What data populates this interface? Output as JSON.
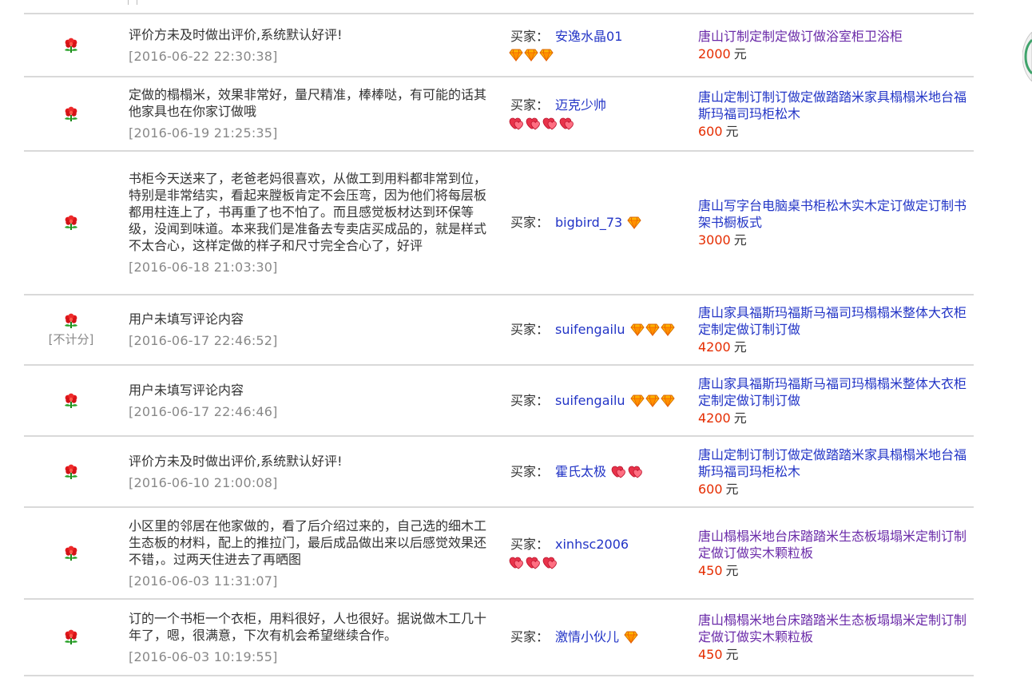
{
  "colors": {
    "divider": "#d9d9d9",
    "link": "#2234c6",
    "visited_link": "#6a2aa8",
    "price": "#e52c00",
    "muted": "#888888"
  },
  "labels": {
    "buyer": "买家：",
    "currency_unit": "元",
    "not_counted": "[不计分]"
  },
  "reviews": [
    {
      "rating_icon": "red-flower-icon",
      "comment": "评价方未及时做出评价,系统默认好评!",
      "date": "[2016-06-22 22:30:38]",
      "buyer_name": "安逸水晶01",
      "buyer_badge": "diamond-icon",
      "buyer_badge_count": 3,
      "item_title": "唐山订制定制定做订做浴室柜卫浴柜",
      "item_title_color": "#6a2aa8",
      "price": "2000"
    },
    {
      "rating_icon": "red-flower-icon",
      "comment": "定做的榻榻米，效果非常好，量尺精准，棒棒哒，有可能的话其他家具也在你家订做哦",
      "date": "[2016-06-19 21:25:35]",
      "buyer_name": "迈克少帅",
      "buyer_badge": "heart-icon",
      "buyer_badge_count": 4,
      "item_title": "唐山定制订制订做定做踏踏米家具榻榻米地台福斯玛福司玛柜松木",
      "item_title_color": "#2234c6",
      "price": "600"
    },
    {
      "rating_icon": "red-flower-icon",
      "comment": "书柜今天送来了，老爸老妈很喜欢，从做工到用料都非常到位，特别是非常结实，看起来膛板肯定不会压弯，因为他们将每层板都用柱连上了，书再重了也不怕了。而且感觉板材达到环保等级，没闻到味道。本来我们是准备去专卖店买成品的，就是样式不太合心，这样定做的样子和尺寸完全合心了，好评",
      "date": "[2016-06-18 21:03:30]",
      "buyer_name": "bigbird_73",
      "buyer_badge": "diamond-icon",
      "buyer_badge_count": 1,
      "item_title": "唐山写字台电脑桌书柜松木实木定订做定订制书架书橱板式",
      "item_title_color": "#2234c6",
      "price": "3000"
    },
    {
      "rating_icon": "red-flower-icon",
      "not_counted": true,
      "comment": "用户未填写评论内容",
      "date": "[2016-06-17 22:46:52]",
      "buyer_name": "suifengailu",
      "buyer_badge": "diamond-icon",
      "buyer_badge_count": 3,
      "item_title": "唐山家具福斯玛福斯马福司玛榻榻米整体大衣柜定制定做订制订做",
      "item_title_color": "#2234c6",
      "price": "4200"
    },
    {
      "rating_icon": "red-flower-icon",
      "comment": "用户未填写评论内容",
      "date": "[2016-06-17 22:46:46]",
      "buyer_name": "suifengailu",
      "buyer_badge": "diamond-icon",
      "buyer_badge_count": 3,
      "item_title": "唐山家具福斯玛福斯马福司玛榻榻米整体大衣柜定制定做订制订做",
      "item_title_color": "#2234c6",
      "price": "4200"
    },
    {
      "rating_icon": "red-flower-icon",
      "comment": "评价方未及时做出评价,系统默认好评!",
      "date": "[2016-06-10 21:00:08]",
      "buyer_name": "霍氏太极",
      "buyer_badge": "heart-icon",
      "buyer_badge_count": 2,
      "item_title": "唐山定制订制订做定做踏踏米家具榻榻米地台福斯玛福司玛柜松木",
      "item_title_color": "#2234c6",
      "price": "600"
    },
    {
      "rating_icon": "red-flower-icon",
      "comment": "小区里的邻居在他家做的，看了后介绍过来的，自己选的细木工生态板的材料，配上的推拉门，最后成品做出来以后感觉效果还不错，。过两天住进去了再晒图",
      "date": "[2016-06-03 11:31:07]",
      "buyer_name": "xinhsc2006",
      "buyer_badge": "heart-icon",
      "buyer_badge_count": 3,
      "item_title": "唐山榻榻米地台床踏踏米生态板塌塌米定制订制定做订做实木颗粒板",
      "item_title_color": "#6a2aa8",
      "price": "450"
    },
    {
      "rating_icon": "red-flower-icon",
      "comment": "订的一个书柜一个衣柜，用料很好，人也很好。据说做木工几十年了，嗯，很满意，下次有机会希望继续合作。",
      "date": "[2016-06-03 10:19:55]",
      "buyer_name": "激情小伙儿",
      "buyer_badge": "diamond-icon",
      "buyer_badge_count": 1,
      "item_title": "唐山榻榻米地台床踏踏米生态板塌塌米定制订制定做订做实木颗粒板",
      "item_title_color": "#6a2aa8",
      "price": "450"
    }
  ]
}
